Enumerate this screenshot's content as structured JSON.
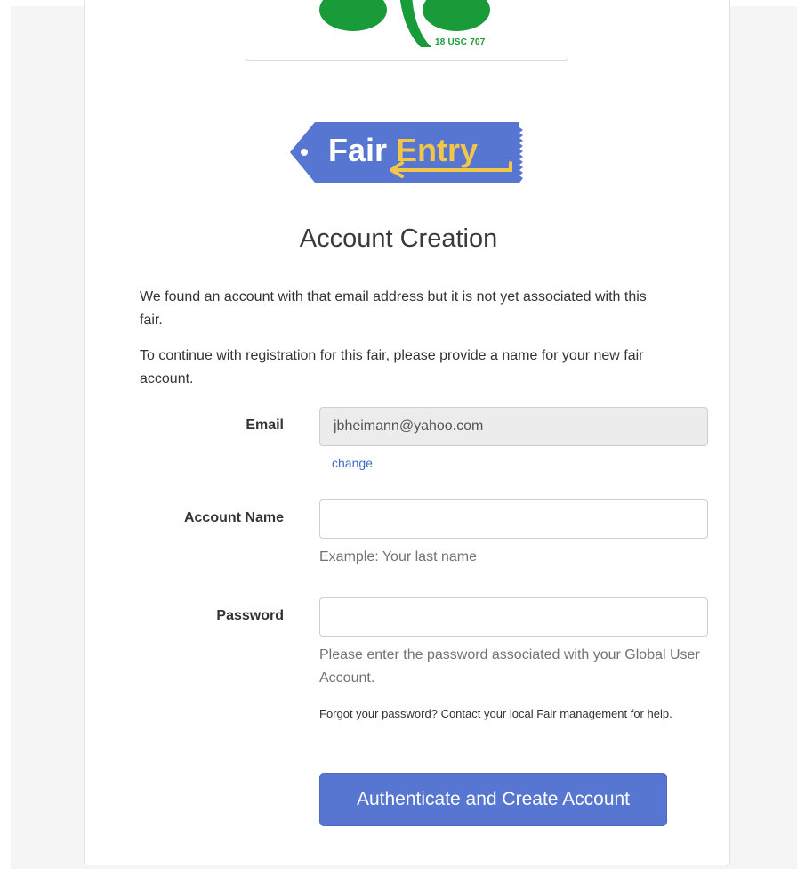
{
  "seal": {
    "caption": "18 USC 707"
  },
  "logo": {
    "part1": "Fair",
    "part2": "Entry"
  },
  "page": {
    "title": "Account Creation",
    "intro1": "We found an account with that email address but it is not yet associated with this fair.",
    "intro2": "To continue with registration for this fair, please provide a name for your new fair account."
  },
  "form": {
    "email": {
      "label": "Email",
      "value": "jbheimann@yahoo.com",
      "change_link": "change"
    },
    "account_name": {
      "label": "Account Name",
      "value": "",
      "placeholder": "",
      "help": "Example: Your last name"
    },
    "password": {
      "label": "Password",
      "value": "",
      "placeholder": "",
      "help": "Please enter the password associated with your Global User Account.",
      "forgot": "Forgot your password? Contact your local Fair management for help."
    },
    "submit_label": "Authenticate and Create Account"
  },
  "colors": {
    "primary": "#5676d1",
    "logo_blue": "#5676d1",
    "logo_yellow": "#f1c649",
    "clover_green": "#1a9b3a",
    "link": "#3b6bc7"
  }
}
